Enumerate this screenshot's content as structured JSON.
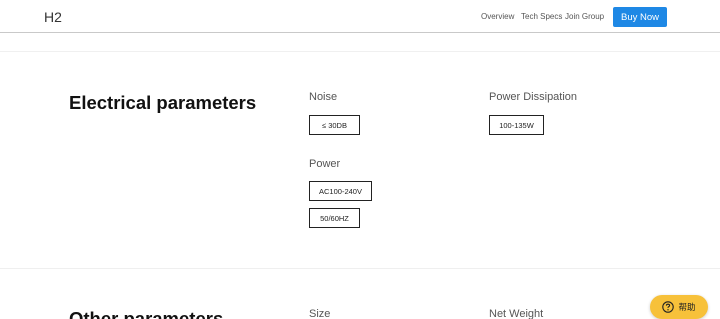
{
  "header": {
    "brand": "H2",
    "nav": [
      {
        "label": "Overview"
      },
      {
        "label": "Tech Specs"
      },
      {
        "label": "Join Group"
      }
    ],
    "buy_label": "Buy Now"
  },
  "electrical": {
    "title": "Electrical parameters",
    "noise": {
      "label": "Noise",
      "values": [
        "≤ 30DB"
      ]
    },
    "power_dissipation": {
      "label": "Power Dissipation",
      "values": [
        "100-135W"
      ]
    },
    "power": {
      "label": "Power",
      "values": [
        "AC100-240V",
        "50/60HZ"
      ]
    }
  },
  "other": {
    "title": "Other parameters",
    "size": {
      "label": "Size"
    },
    "net_weight": {
      "label": "Net Weight"
    }
  },
  "help": {
    "label": "帮助",
    "icon": "help-icon"
  },
  "colors": {
    "accent": "#1e88e5",
    "help_bg": "#f7c13a"
  }
}
